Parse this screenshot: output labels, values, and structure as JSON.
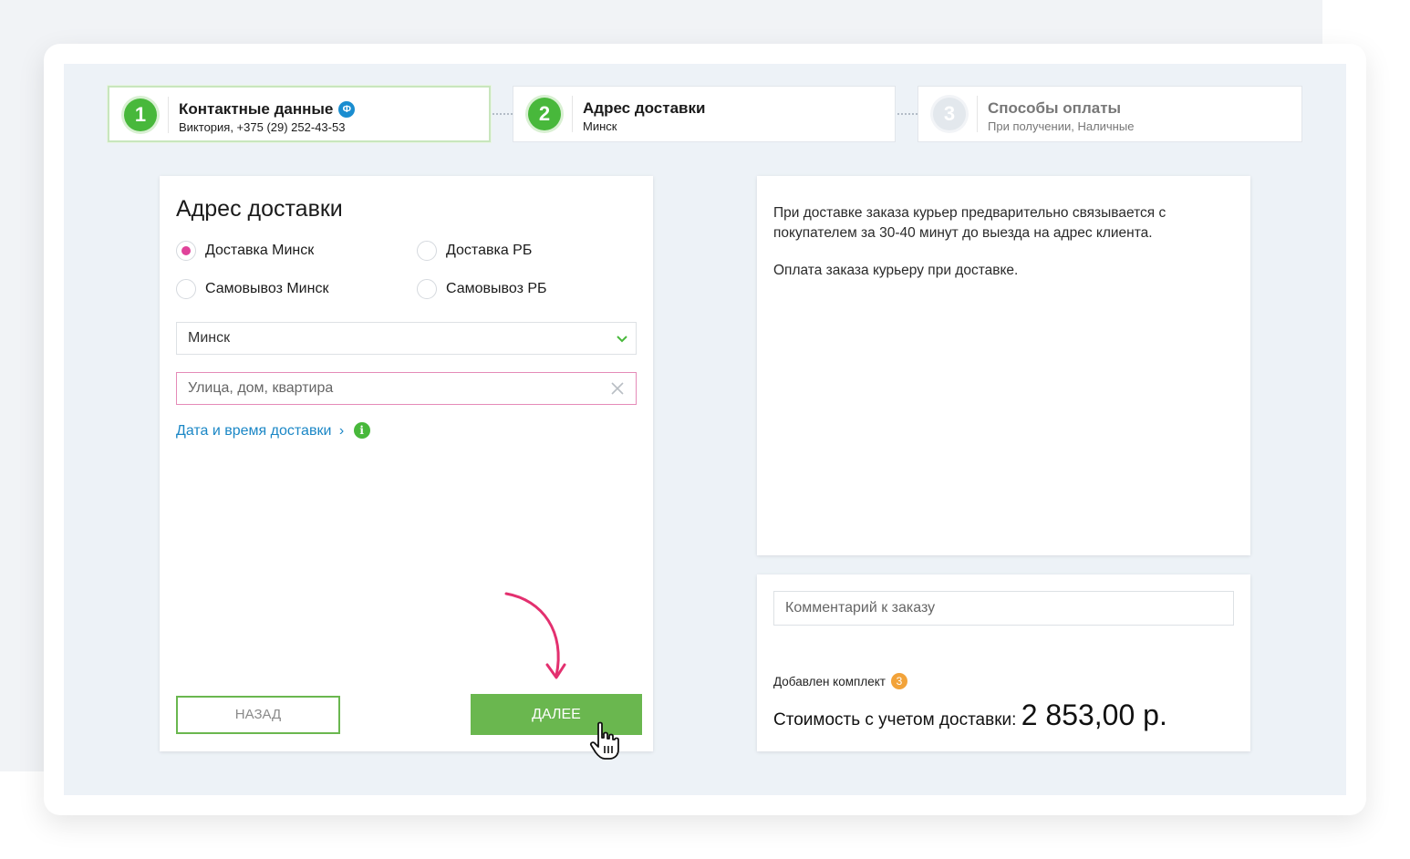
{
  "steps": [
    {
      "number": "1",
      "title": "Контактные данные",
      "subtitle": "Виктория, +375 (29) 252-43-53",
      "badge": "Ф"
    },
    {
      "number": "2",
      "title": "Адрес доставки",
      "subtitle": "Минск"
    },
    {
      "number": "3",
      "title": "Способы оплаты",
      "subtitle": "При получении, Наличные"
    }
  ],
  "address_form": {
    "title": "Адрес доставки",
    "options": [
      "Доставка Минск",
      "Доставка РБ",
      "Самовывоз Минск",
      "Самовывоз РБ"
    ],
    "selected_option": "Доставка Минск",
    "city_select_value": "Минск",
    "street_placeholder": "Улица, дом, квартира",
    "date_link": "Дата и время доставки",
    "date_link_chevron": "›",
    "info_icon": "i",
    "back_button": "НАЗАД",
    "next_button": "ДАЛЕЕ"
  },
  "info": {
    "paragraph_1": "При доставке заказа курьер предварительно связывается с покупателем за 30-40 минут до выезда на адрес клиента.",
    "paragraph_2": "Оплата заказа курьеру при доставке."
  },
  "summary": {
    "comment_placeholder": "Комментарий к заказу",
    "kit_label": "Добавлен комплект",
    "kit_count": "3",
    "total_label": "Стоимость с учетом доставки:",
    "total_amount": "2 853,00 р."
  },
  "colors": {
    "accent_green": "#6ab74f",
    "step_green": "#48b83b",
    "radio_pink": "#e0439a",
    "link_blue": "#1b87c6",
    "badge_orange": "#f2a33a",
    "arrow_pink": "#e3306f"
  },
  "icons": [
    "info-badge-icon",
    "chevron-down-icon",
    "clear-icon",
    "info-icon",
    "hand-cursor-icon",
    "curved-arrow-icon"
  ]
}
